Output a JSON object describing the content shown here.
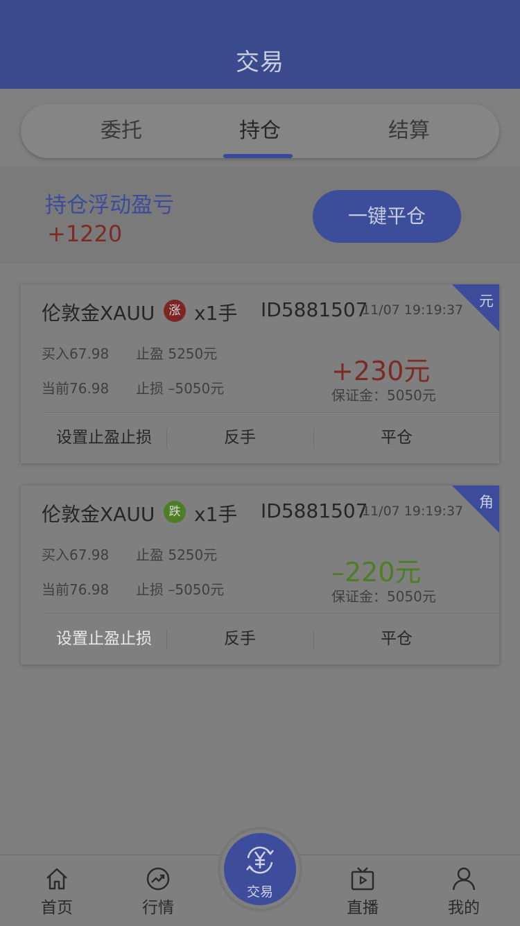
{
  "header": {
    "title": "交易"
  },
  "tabs": [
    {
      "label": "委托"
    },
    {
      "label": "持仓"
    },
    {
      "label": "结算"
    }
  ],
  "summary": {
    "label": "持仓浮动盈亏",
    "value": "+1220",
    "close_all_label": "一键平仓"
  },
  "positions": [
    {
      "name": "伦敦金XAUU",
      "direction": "涨",
      "lots": "x1手",
      "id": "ID5881507",
      "time": "11/07 19:19:37",
      "unit": "元",
      "buy": "买入67.98",
      "take_profit": "止盈 5250元",
      "current": "当前76.98",
      "stop_loss": "止损 –5050元",
      "pnl": "+230元",
      "margin": "保证金：5050元",
      "actions": [
        "设置止盈止损",
        "反手",
        "平仓"
      ]
    },
    {
      "name": "伦敦金XAUU",
      "direction": "跌",
      "lots": "x1手",
      "id": "ID5881507",
      "time": "11/07 19:19:37",
      "unit": "角",
      "buy": "买入67.98",
      "take_profit": "止盈 5250元",
      "current": "当前76.98",
      "stop_loss": "止损 –5050元",
      "pnl": "–220元",
      "margin": "保证金：5050元",
      "actions": [
        "设置止盈止损",
        "反手",
        "平仓"
      ]
    }
  ],
  "nav": [
    {
      "label": "首页",
      "icon": "home-icon"
    },
    {
      "label": "行情",
      "icon": "market-trend-icon"
    },
    {
      "label": "交易",
      "icon": "yen-exchange-icon"
    },
    {
      "label": "直播",
      "icon": "tv-play-icon"
    },
    {
      "label": "我的",
      "icon": "user-icon"
    }
  ],
  "colors": {
    "primary": "#3c4b9a",
    "rise": "#7d2a25",
    "fall": "#4d7d24"
  }
}
